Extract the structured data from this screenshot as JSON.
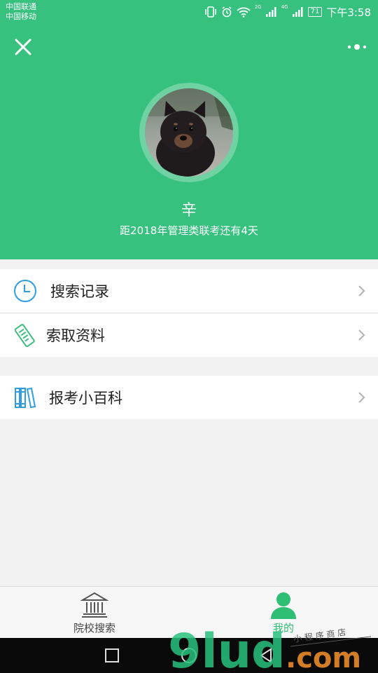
{
  "status_bar": {
    "carrier_1": "中国联通",
    "carrier_2": "中国移动",
    "net_1": "2G",
    "net_2": "4G",
    "battery": "71",
    "time": "下午3:58"
  },
  "profile": {
    "name": "辛",
    "countdown": "距2018年管理类联考还有4天"
  },
  "menu": {
    "search_history": "搜索记录",
    "get_materials": "索取资料",
    "exam_encyclopedia": "报考小百科"
  },
  "tabbar": {
    "tab_school_search": "院校搜索",
    "tab_mine": "我的"
  },
  "watermark": {
    "brand": "9lud",
    "domain": ".com",
    "tagline": "小 程 序 商 店"
  },
  "colors": {
    "brand_green": "#36c17f",
    "tab_active": "#2fbf74",
    "icon_blue": "#2f9de0"
  }
}
